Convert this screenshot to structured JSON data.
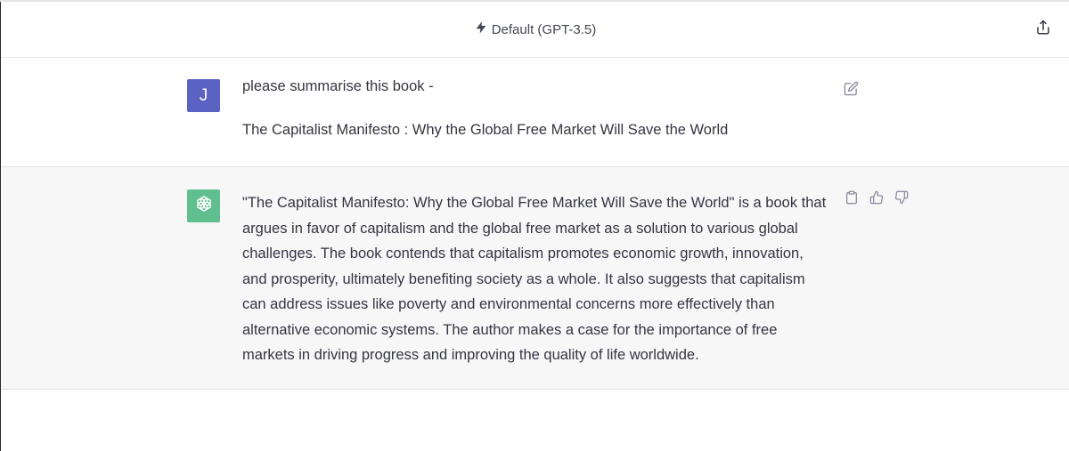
{
  "header": {
    "model_label": "Default (GPT-3.5)",
    "model_icon": "lightning-bolt-icon",
    "share_icon": "share-icon"
  },
  "user_message": {
    "avatar_initial": "J",
    "line1": "please summarise this book -",
    "line2": "The Capitalist Manifesto : Why the Global Free Market Will Save the World",
    "edit_icon": "edit-icon"
  },
  "assistant_message": {
    "avatar_icon": "openai-logo-icon",
    "text": "\"The Capitalist Manifesto: Why the Global Free Market Will Save the World\" is a book that argues in favor of capitalism and the global free market as a solution to various global challenges. The book contends that capitalism promotes economic growth, innovation, and prosperity, ultimately benefiting society as a whole. It also suggests that capitalism can address issues like poverty and environmental concerns more effectively than alternative economic systems. The author makes a case for the importance of free markets in driving progress and improving the quality of life worldwide.",
    "actions": [
      "copy-icon",
      "thumbs-up-icon",
      "thumbs-down-icon"
    ]
  },
  "colors": {
    "user_avatar": "#5b63c2",
    "assistant_avatar": "#5fbf8f",
    "assistant_bg": "#f7f7f8"
  }
}
